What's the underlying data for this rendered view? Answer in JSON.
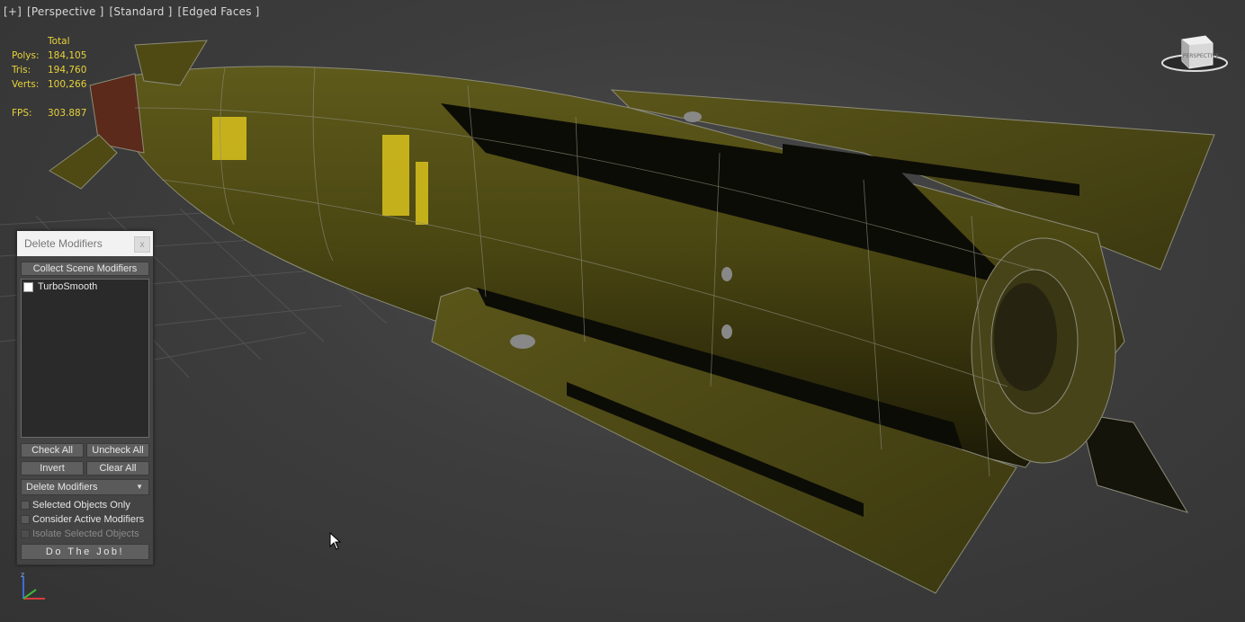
{
  "viewport": {
    "label_parts": [
      "[+]",
      "[Perspective ]",
      "[Standard ]",
      "[Edged Faces ]"
    ],
    "stats": {
      "header": "Total",
      "polys_label": "Polys:",
      "polys": "184,105",
      "tris_label": "Tris:",
      "tris": "194,760",
      "verts_label": "Verts:",
      "verts": "100,266",
      "fps_label": "FPS:",
      "fps": "303.887"
    },
    "viewcube_label": "PERSPECTIVE",
    "axis_label": "z"
  },
  "dialog": {
    "title": "Delete Modifiers",
    "close_glyph": "x",
    "collect_button": "Collect Scene Modifiers",
    "modifiers": [
      {
        "label": "TurboSmooth",
        "checked": false
      }
    ],
    "check_all": "Check All",
    "uncheck_all": "Uncheck All",
    "invert": "Invert",
    "clear_all": "Clear All",
    "mode_select": "Delete Modifiers",
    "options": [
      {
        "label": "Selected Objects Only",
        "checked": false,
        "enabled": true
      },
      {
        "label": "Consider Active Modifiers",
        "checked": false,
        "enabled": true
      },
      {
        "label": "Isolate Selected Objects",
        "checked": false,
        "enabled": false
      }
    ],
    "do_job": "Do The Job!"
  },
  "colors": {
    "viewport_bg": "#3d3d3d",
    "stats_yellow": "#e8d23a",
    "model_olive": "#4f4a14",
    "wire": "#8c8c7a"
  }
}
